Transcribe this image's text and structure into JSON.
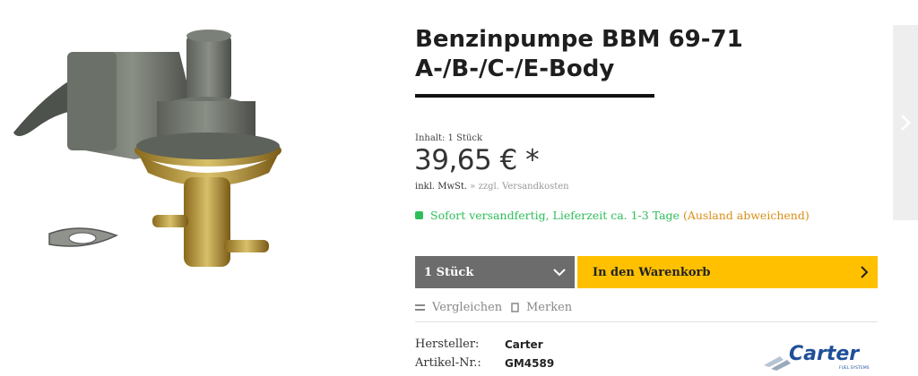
{
  "product": {
    "title": "Benzinpumpe BBM 69-71 A-/B-/C-/E-Body",
    "content": "Inhalt: 1 Stück",
    "price": "39,65 € *",
    "tax_note": "inkl. MwSt.",
    "shipping_link": "» zzgl. Versandkosten",
    "delivery_status": "Sofort versandfertig, Lieferzeit ca. 1-3 Tage",
    "delivery_note": "(Ausland abweichend)"
  },
  "buy": {
    "quantity": "1 Stück",
    "cart_label": "In den Warenkorb"
  },
  "actions": {
    "compare": "Vergleichen",
    "wishlist": "Merken"
  },
  "specs": [
    {
      "label": "Hersteller:",
      "value": "Carter"
    },
    {
      "label": "Artikel-Nr.:",
      "value": "GM4589"
    }
  ],
  "brand_logo": {
    "name": "Carter",
    "tagline": "FUEL SYSTEMS"
  },
  "colors": {
    "cart_button": "#ffc000",
    "quantity_select": "#6c6c6c",
    "in_stock": "#2ebd5a",
    "delivery_note": "#d98f17"
  },
  "icons": [
    "chevron-right-icon",
    "chevron-down-icon",
    "compare-icon",
    "wishlist-icon",
    "status-dot-icon"
  ]
}
